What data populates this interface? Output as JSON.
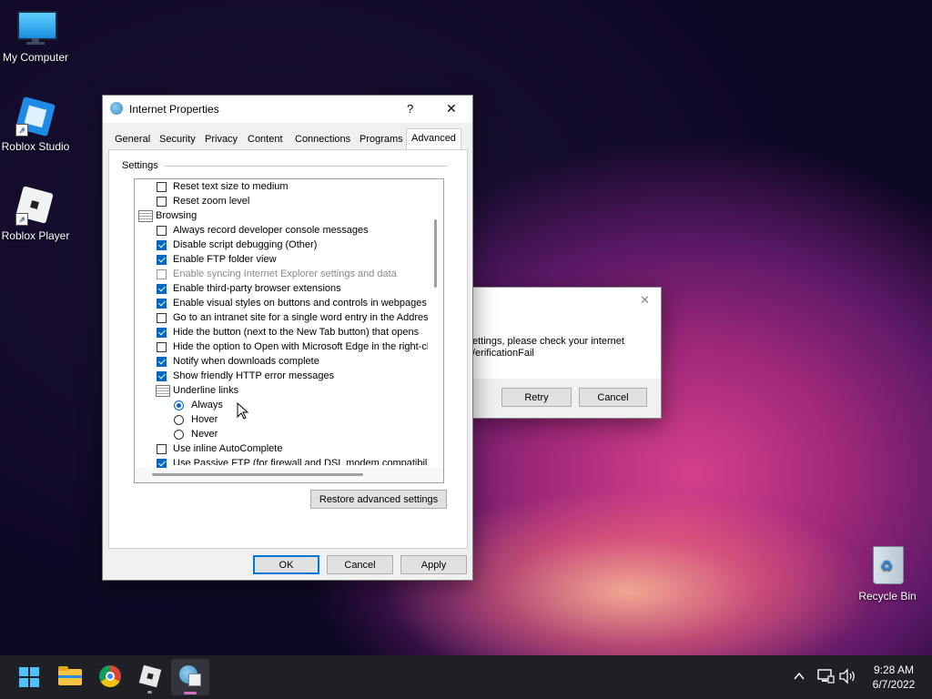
{
  "desktop": {
    "icons": [
      {
        "label": "My Computer",
        "icon": "monitor-icon"
      },
      {
        "label": "Roblox Studio",
        "icon": "roblox-studio-icon"
      },
      {
        "label": "Roblox Player",
        "icon": "roblox-player-icon"
      },
      {
        "label": "Recycle Bin",
        "icon": "recycle-bin-icon"
      }
    ]
  },
  "error_dialog": {
    "text_line1": "ettings, please check your internet",
    "text_line2": "/erificationFail",
    "retry": "Retry",
    "cancel": "Cancel",
    "close": "✕"
  },
  "props": {
    "title": "Internet Properties",
    "help": "?",
    "close": "✕",
    "tabs": [
      "General",
      "Security",
      "Privacy",
      "Content",
      "Connections",
      "Programs",
      "Advanced"
    ],
    "active_tab": "Advanced",
    "settings_label": "Settings",
    "items": [
      {
        "type": "check",
        "checked": false,
        "label": "Reset text size to medium"
      },
      {
        "type": "check",
        "checked": false,
        "label": "Reset zoom level"
      },
      {
        "type": "category",
        "label": "Browsing"
      },
      {
        "type": "check",
        "checked": false,
        "label": "Always record developer console messages"
      },
      {
        "type": "check",
        "checked": true,
        "label": "Disable script debugging (Other)"
      },
      {
        "type": "check",
        "checked": true,
        "label": "Enable FTP folder view"
      },
      {
        "type": "check",
        "checked": false,
        "disabled": true,
        "label": "Enable syncing Internet Explorer settings and data"
      },
      {
        "type": "check",
        "checked": true,
        "label": "Enable third-party browser extensions"
      },
      {
        "type": "check",
        "checked": true,
        "label": "Enable visual styles on buttons and controls in webpages"
      },
      {
        "type": "check",
        "checked": false,
        "label": "Go to an intranet site for a single word entry in the Addres"
      },
      {
        "type": "check",
        "checked": true,
        "label": "Hide the button (next to the New Tab button) that opens"
      },
      {
        "type": "check",
        "checked": false,
        "label": "Hide the option to Open with Microsoft Edge in the right-cl"
      },
      {
        "type": "check",
        "checked": true,
        "label": "Notify when downloads complete"
      },
      {
        "type": "check",
        "checked": true,
        "label": "Show friendly HTTP error messages"
      },
      {
        "type": "subcategory",
        "label": "Underline links"
      },
      {
        "type": "radio",
        "checked": true,
        "label": "Always"
      },
      {
        "type": "radio",
        "checked": false,
        "label": "Hover"
      },
      {
        "type": "radio",
        "checked": false,
        "label": "Never"
      },
      {
        "type": "check",
        "checked": false,
        "label": "Use inline AutoComplete"
      },
      {
        "type": "check",
        "checked": true,
        "label": "Use Passive FTP (for firewall and DSL modem compatibility"
      }
    ],
    "restore_button": "Restore advanced settings",
    "ok": "OK",
    "cancel": "Cancel",
    "apply": "Apply"
  },
  "taskbar": {
    "apps": [
      "windows-start-icon",
      "file-explorer-icon",
      "chrome-icon",
      "roblox-icon",
      "internet-options-icon"
    ],
    "time": "9:28 AM",
    "date": "6/7/2022",
    "tray": [
      "chevron-up-icon",
      "network-icon",
      "volume-icon"
    ]
  }
}
